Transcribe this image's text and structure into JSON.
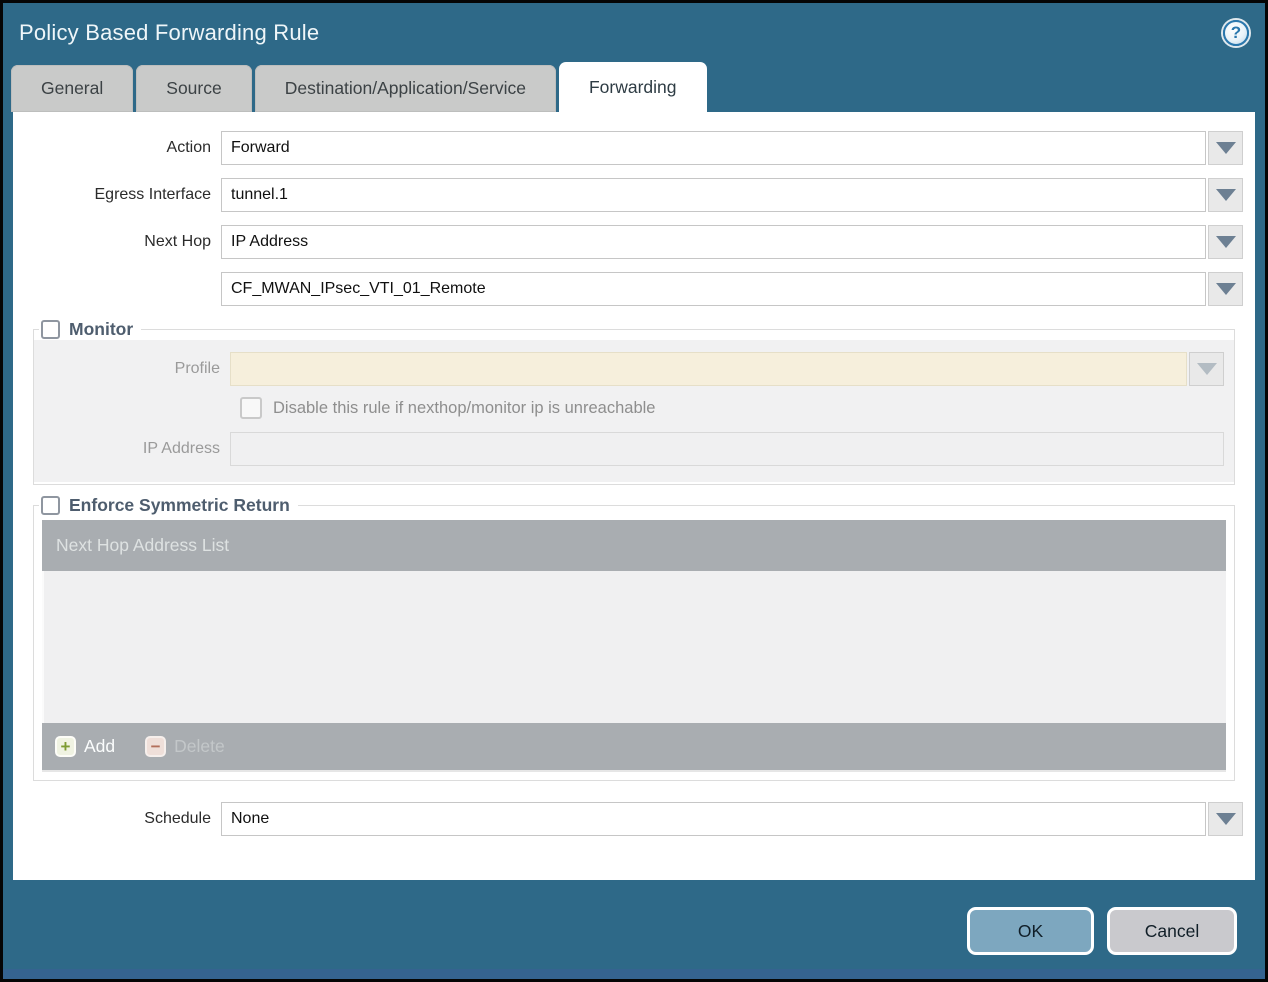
{
  "window": {
    "title": "Policy Based Forwarding Rule"
  },
  "tabs": [
    {
      "label": "General",
      "active": false
    },
    {
      "label": "Source",
      "active": false
    },
    {
      "label": "Destination/Application/Service",
      "active": false
    },
    {
      "label": "Forwarding",
      "active": true
    }
  ],
  "form": {
    "action": {
      "label": "Action",
      "value": "Forward"
    },
    "egress_interface": {
      "label": "Egress Interface",
      "value": "tunnel.1"
    },
    "next_hop": {
      "label": "Next Hop",
      "value": "IP Address"
    },
    "next_hop_address": {
      "value": "CF_MWAN_IPsec_VTI_01_Remote"
    },
    "monitor": {
      "label": "Monitor",
      "checked": false,
      "profile": {
        "label": "Profile",
        "value": ""
      },
      "disable_rule": {
        "label": "Disable this rule if nexthop/monitor ip is unreachable",
        "checked": false
      },
      "ip_address": {
        "label": "IP Address",
        "value": ""
      }
    },
    "enforce_symmetric_return": {
      "label": "Enforce Symmetric Return",
      "checked": false,
      "table": {
        "header": "Next Hop Address List",
        "rows": [],
        "add_label": "Add",
        "delete_label": "Delete",
        "delete_enabled": false
      }
    },
    "schedule": {
      "label": "Schedule",
      "value": "None"
    }
  },
  "footer": {
    "ok_label": "OK",
    "cancel_label": "Cancel"
  },
  "icons": {
    "help": "help-icon",
    "dropdown": "chevron-down-icon",
    "add": "plus-icon",
    "delete": "minus-icon"
  },
  "colors": {
    "titlebar": "#2e6988",
    "active_tab": "#ffffff",
    "inactive_tab": "#c9cac9",
    "legend_text": "#4e5d6e",
    "disabled_field_cream": "#f6efdc",
    "table_bar": "#a9adb1",
    "ok_button": "#7da7bf",
    "cancel_button": "#c9c9cd",
    "add_icon_green": "#7e9c33",
    "delete_icon_red": "#b3705c"
  }
}
